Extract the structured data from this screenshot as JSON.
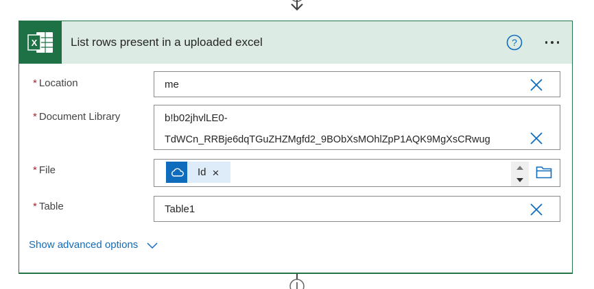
{
  "card": {
    "title": "List rows present in a uploaded excel",
    "app_icon": "excel-icon",
    "header_color": "#dcebe3",
    "brand_color": "#1e7145",
    "accent_color": "#0f6cbd"
  },
  "fields": {
    "location": {
      "label": "Location",
      "required_mark": "*",
      "value": "me"
    },
    "library": {
      "label": "Document Library",
      "required_mark": "*",
      "value_line1": "b!b02jhvlLE0-",
      "value_line2": "TdWCn_RRBje6dqTGuZHZMgfd2_9BObXsMOhlZpP1AQK9MgXsCRwug"
    },
    "file": {
      "label": "File",
      "required_mark": "*",
      "token_label": "Id",
      "token_icon": "onedrive-cloud-icon",
      "token_remove": "×"
    },
    "table": {
      "label": "Table",
      "required_mark": "*",
      "value": "Table1"
    }
  },
  "advanced": {
    "label": "Show advanced options"
  }
}
